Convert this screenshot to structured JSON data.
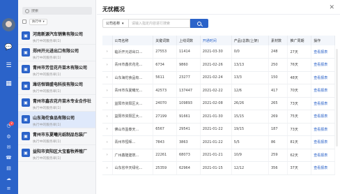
{
  "rail": {
    "badges": [
      "2"
    ]
  },
  "list": {
    "search_placeholder": "搜索",
    "filter_label": "执行中",
    "items": [
      {
        "name": "河南新源汽车销售有限公司",
        "sub": "执行中的服务单(1)"
      },
      {
        "name": "郑州开元进出口有限公司",
        "sub": "执行中的服务单(1)"
      },
      {
        "name": "青州市芳佳花卉苗木有限公司",
        "sub": "执行中的服务单(1)"
      },
      {
        "name": "潍坊恒锦盛电科技有限公司",
        "sub": "执行中的服务单(1)"
      },
      {
        "name": "青州市鑫农花卉苗木专业合作社",
        "sub": "执行中的服务单(1)"
      },
      {
        "name": "山东海佗食品有限公司",
        "sub": "执行中的服务单(1)"
      },
      {
        "name": "青州市东夏曦光纸制品包装厂",
        "sub": "执行中的服务单(1)"
      },
      {
        "name": "益阳市资阳区大宝畜牧养殖厂",
        "sub": "执行中的服务单(1)"
      }
    ]
  },
  "main": {
    "title": "无忧概况",
    "query": {
      "select_label": "公司名称",
      "placeholder": "请输入指定内容进行搜索"
    },
    "columns": [
      "",
      "公司名称",
      "关键词数",
      "上线词数",
      "开通时间",
      "产品(总数/上架)",
      "素材数",
      "推广周期",
      "操作"
    ],
    "rows": [
      [
        "›",
        "临沂开元进出口…",
        "27553",
        "11414",
        "2021-03-30",
        "0/0",
        "248",
        "27天",
        "查看报表"
      ],
      [
        "›",
        "青州市鑫农花花…",
        "6734",
        "9860",
        "2021-02-26",
        "13/13",
        "250",
        "76天",
        "查看报表"
      ],
      [
        "›",
        "山东海佗食品有…",
        "5611",
        "23277",
        "2021-02-24",
        "13/3",
        "150",
        "48天",
        "查看报表"
      ],
      [
        "›",
        "青州市东夏曦光…",
        "42573",
        "137447",
        "2021-02-22",
        "12/6",
        "417",
        "70天",
        "查看报表"
      ],
      [
        "›",
        "益阳市资阳区大…",
        "24070",
        "109893",
        "2021-02-08",
        "26/26",
        "265",
        "73天",
        "查看报表"
      ],
      [
        "›",
        "益阳市资阳区大…",
        "27199",
        "91661",
        "2021-01-30",
        "15/15",
        "269",
        "75天",
        "查看报表"
      ],
      [
        "›",
        "佛山市盈泰天…",
        "6567",
        "29541",
        "2021-01-22",
        "19/15",
        "187",
        "73天",
        "查看报表"
      ],
      [
        "›",
        "青州市恒晖…",
        "7843",
        "3863",
        "2021-01-22",
        "5/5",
        "86",
        "81天",
        "查看报表"
      ],
      [
        "›",
        "广州鑫隆建筑…",
        "22261",
        "68073",
        "2021-01-21",
        "10/9",
        "259",
        "62天",
        "查看报表"
      ],
      [
        "›",
        "山东省中天绿化…",
        "25359",
        "62964",
        "2021-01-15",
        "12/12",
        "356",
        "37天",
        "查看报表"
      ]
    ]
  }
}
